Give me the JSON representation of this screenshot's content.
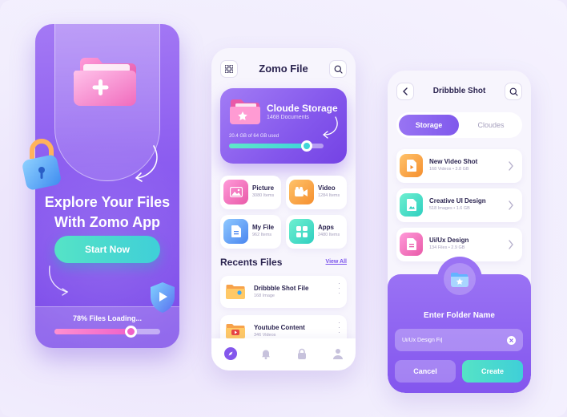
{
  "onboarding": {
    "title_line1": "Explore Your Files",
    "title_line2": "With Zomo App",
    "start_button": "Start Now",
    "loading_text": "78% Files Loading...",
    "loading_progress": 0.72
  },
  "home": {
    "title": "Zomo File",
    "storage": {
      "title": "Cloude Storage",
      "documents": "1468 Documents",
      "used_text": "20.4 GB of 64 GB used",
      "progress": 0.82
    },
    "categories": [
      {
        "name": "Picture",
        "count": "3080 Items"
      },
      {
        "name": "Video",
        "count": "1284 Items"
      },
      {
        "name": "My File",
        "count": "962 Items"
      },
      {
        "name": "Apps",
        "count": "2480 Items"
      }
    ],
    "recents_title": "Recents Files",
    "view_all": "View All",
    "recents": [
      {
        "name": "Dribbble Shot File",
        "count": "168 Image"
      },
      {
        "name": "Youtube Content",
        "count": "346 Videos"
      }
    ]
  },
  "folder": {
    "title": "Dribbble Shot",
    "tabs": [
      "Storage",
      "Cloudes"
    ],
    "items": [
      {
        "name": "New Video Shot",
        "meta": "168 Videos • 3.8 GB"
      },
      {
        "name": "Creative UI Design",
        "meta": "518 Images • 1.6 GB"
      },
      {
        "name": "Ui/Ux Design",
        "meta": "134 Files • 2.9 GB"
      }
    ],
    "dialog": {
      "title": "Enter Folder Name",
      "input_value": "Ui/Ux Design Fi|",
      "cancel": "Cancel",
      "create": "Create"
    }
  },
  "colors": {
    "primary": "#8457ec",
    "accent": "#3fd6d8",
    "pink": "#f062c8",
    "orange": "#f7a24a"
  }
}
